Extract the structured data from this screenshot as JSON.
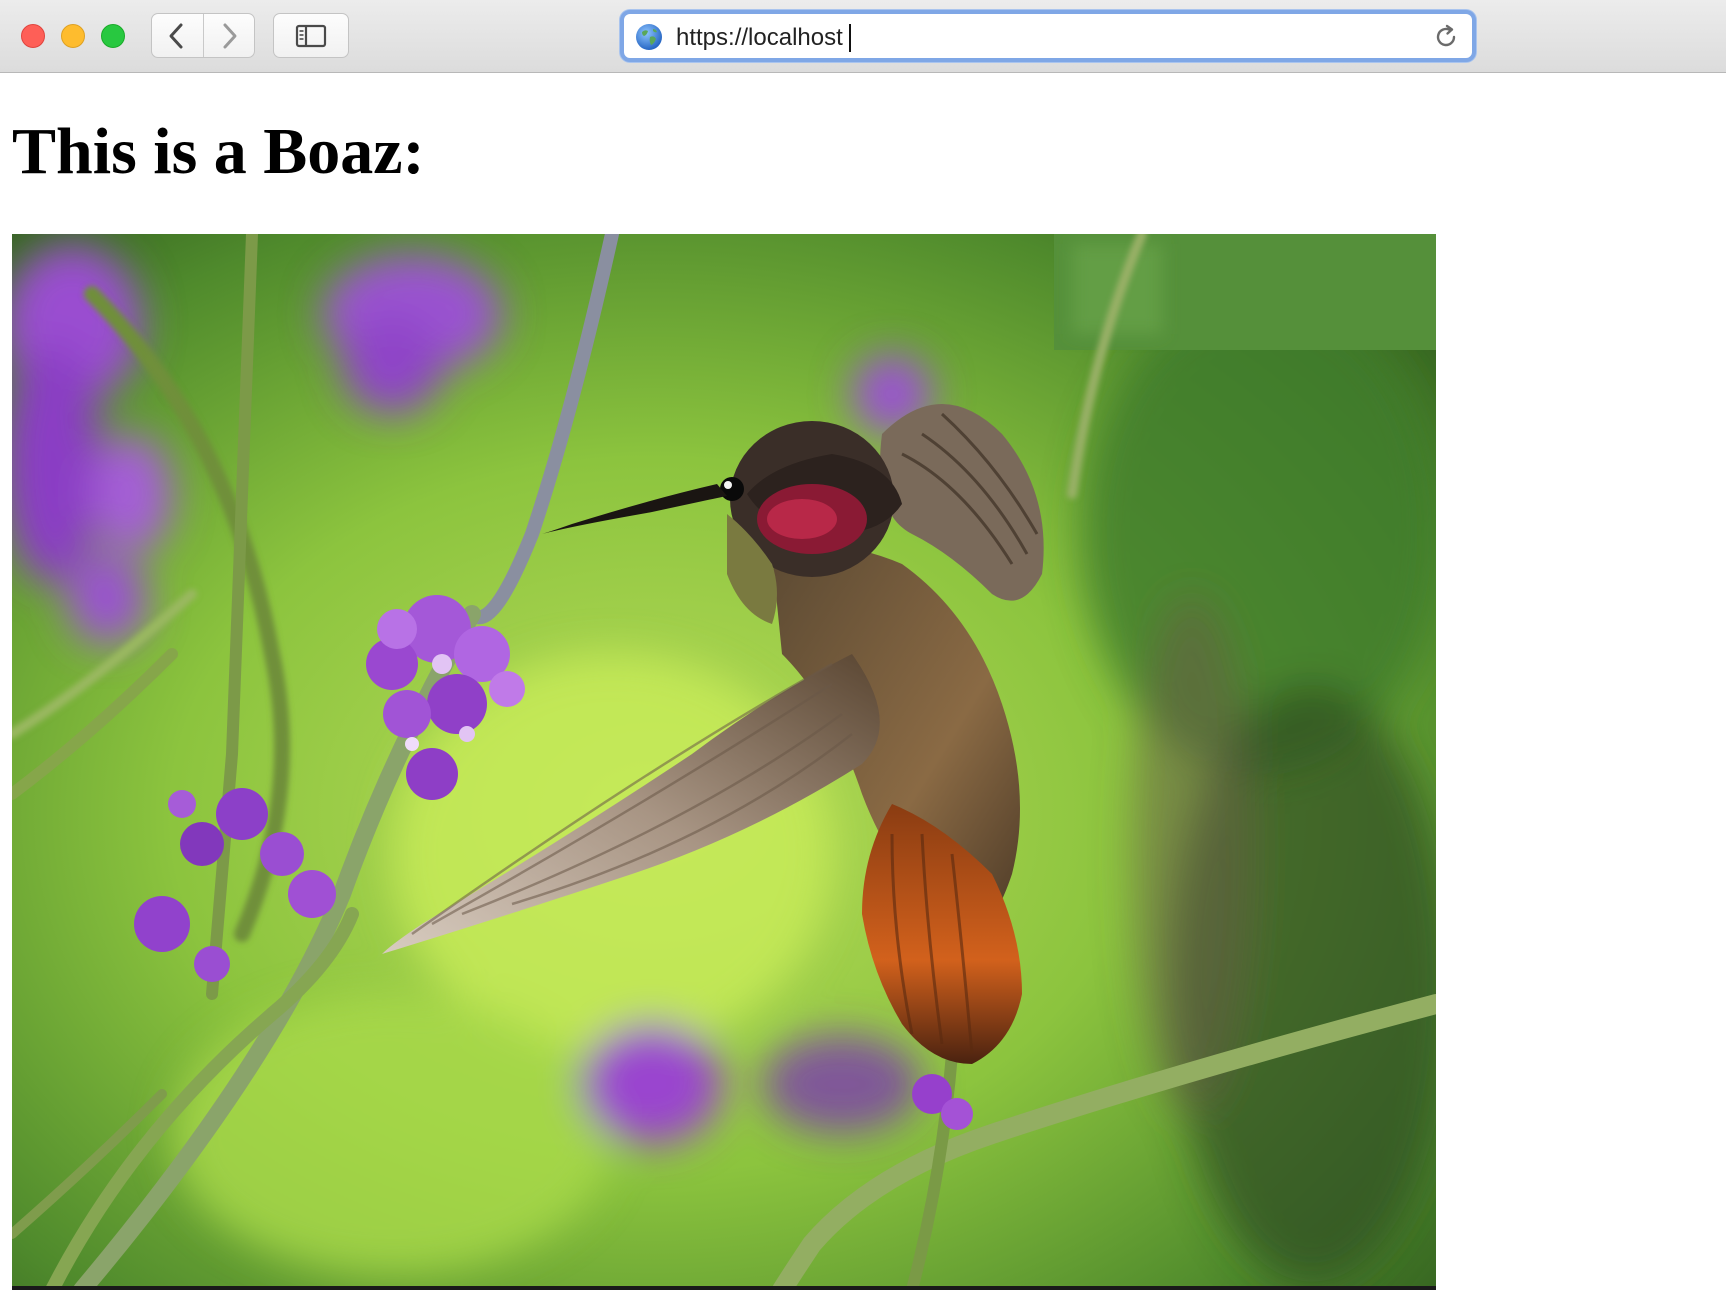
{
  "browser": {
    "address_bar": {
      "url": "https://localhost"
    }
  },
  "page": {
    "heading": "This is a Boaz:"
  },
  "image": {
    "subject_icon": "hummingbird-photo"
  },
  "colors": {
    "address_focus_ring": "#7fa7e6",
    "close": "#fe5f57",
    "minimize": "#febc2e",
    "maximize": "#28c840"
  }
}
